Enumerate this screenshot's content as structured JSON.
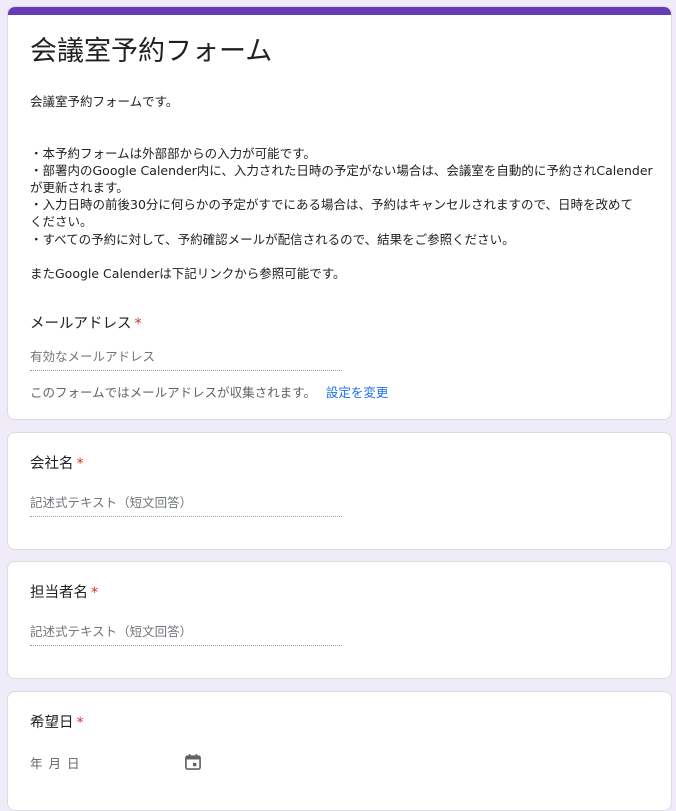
{
  "form": {
    "title": "会議室予約フォーム",
    "description_intro": "会議室予約フォームです。",
    "description_lines": [
      "・本予約フォームは外部部からの入力が可能です。",
      "・部署内のGoogle Calender内に、入力された日時の予定がない場合は、会議室を自動的に予約されCalender",
      "が更新されます。",
      "・入力日時の前後30分に何らかの予定がすでにある場合は、予約はキャンセルされますので、日時を改めて",
      "ください。",
      "・すべての予約に対して、予約確認メールが配信されるので、結果をご参照ください。"
    ],
    "description_outro": "またGoogle Calenderは下記リンクから参照可能です。",
    "accent_color": "#673ab7"
  },
  "email": {
    "label": "メールアドレス",
    "required_mark": "*",
    "placeholder": "有効なメールアドレス",
    "collect_note": "このフォームではメールアドレスが収集されます。",
    "change_settings": "設定を変更"
  },
  "questions": {
    "company": {
      "label": "会社名",
      "required_mark": "*",
      "placeholder": "記述式テキスト（短文回答）"
    },
    "person": {
      "label": "担当者名",
      "required_mark": "*",
      "placeholder": "記述式テキスト（短文回答）"
    },
    "date": {
      "label": "希望日",
      "required_mark": "*",
      "placeholder": "年 月 日",
      "icon": "calendar-icon"
    }
  }
}
